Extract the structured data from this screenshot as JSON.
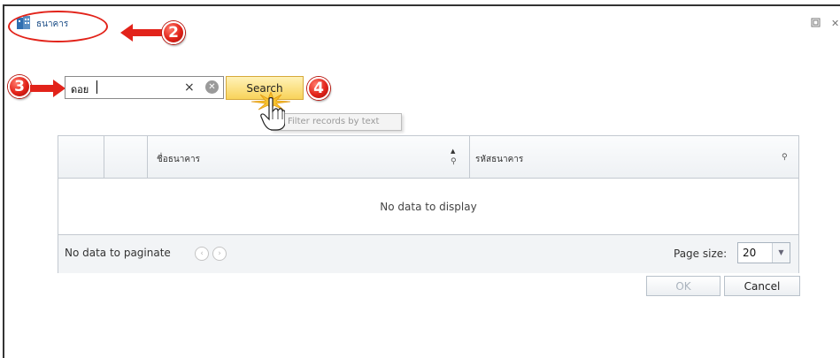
{
  "window": {
    "title": "ธนาคาร",
    "restore_icon": "restore-icon",
    "close_icon": "close-icon",
    "close_glyph": "✕"
  },
  "annotations": {
    "step2": "2",
    "step3": "3",
    "step4": "4"
  },
  "search": {
    "value": "ดอย",
    "clear_glyph": "×",
    "clear_all_glyph": "✕",
    "button_label": "Search",
    "tooltip": "Filter records by text"
  },
  "grid": {
    "columns": [
      {
        "label": ""
      },
      {
        "label": ""
      },
      {
        "label": "ชื่อธนาคาร"
      },
      {
        "label": "รหัสธนาคาร"
      }
    ],
    "empty_text": "No data to display",
    "sort_glyph": "▲",
    "filter_glyph": "⚲",
    "pager": {
      "text": "No data to paginate",
      "prev_glyph": "‹",
      "next_glyph": "›",
      "page_size_label": "Page size:",
      "page_size_value": "20",
      "dropdown_glyph": "▼"
    }
  },
  "buttons": {
    "ok_label": "OK",
    "cancel_label": "Cancel"
  },
  "colors": {
    "annotation_red": "#e2231a",
    "search_button": "#f8d35a",
    "title_blue": "#1a4c86"
  }
}
